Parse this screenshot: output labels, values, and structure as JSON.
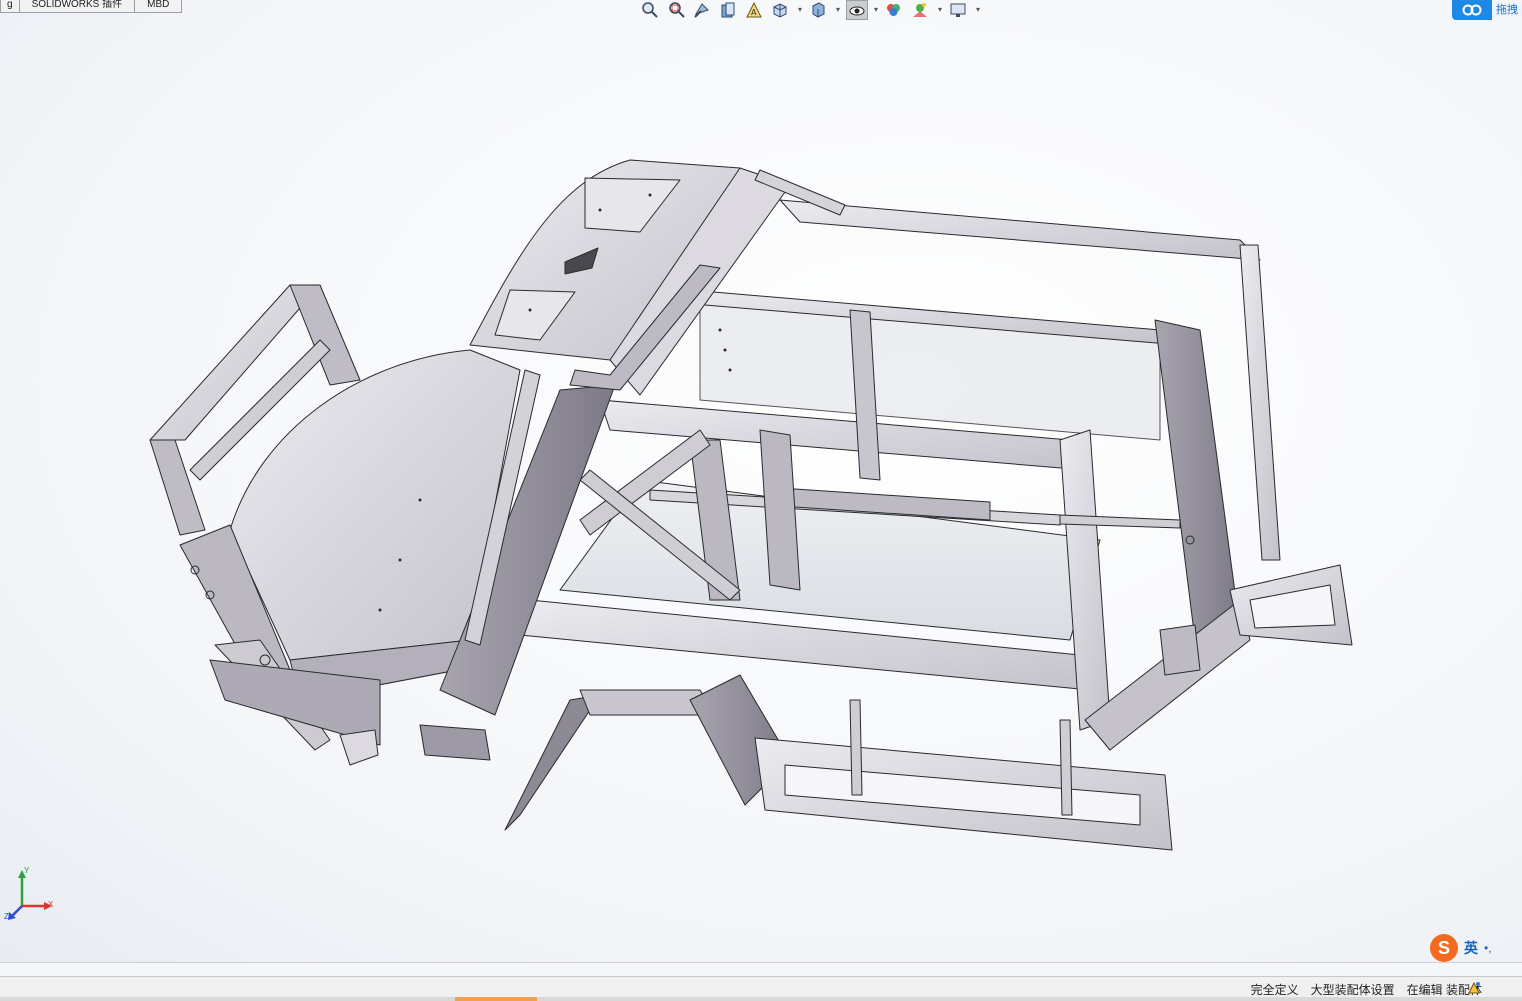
{
  "tabs": [
    {
      "label": "g"
    },
    {
      "label": "SOLIDWORKS 插件"
    },
    {
      "label": "MBD"
    }
  ],
  "heads_up_toolbar": [
    {
      "icon": "zoom-to-fit-icon"
    },
    {
      "icon": "zoom-to-area-icon"
    },
    {
      "icon": "previous-view-icon"
    },
    {
      "icon": "section-view-icon"
    },
    {
      "icon": "dynamic-annotation-icon"
    },
    {
      "icon": "view-orientation-icon"
    },
    {
      "icon": "display-style-icon"
    },
    {
      "icon": "hide-show-items-icon"
    },
    {
      "icon": "edit-appearance-icon"
    },
    {
      "icon": "apply-scene-icon"
    },
    {
      "icon": "view-settings-icon"
    }
  ],
  "cloud": {
    "label": "拖拽",
    "icon": "cloud-link-icon"
  },
  "triad": {
    "x": "X",
    "y": "Y",
    "z": "Z"
  },
  "ime": {
    "logo": "S",
    "lang": "英",
    "punct": "•,"
  },
  "status": {
    "fully_defined": "完全定义",
    "large_assembly": "大型装配体设置",
    "editing": "在编辑 装配体"
  },
  "colors": {
    "metal_face": "#c9c6cf",
    "metal_light": "#e4e2e8",
    "metal_dark": "#8c8894",
    "edge": "#2a2a2e",
    "glass": "#e9ecef",
    "accent_orange": "#f26b21"
  }
}
